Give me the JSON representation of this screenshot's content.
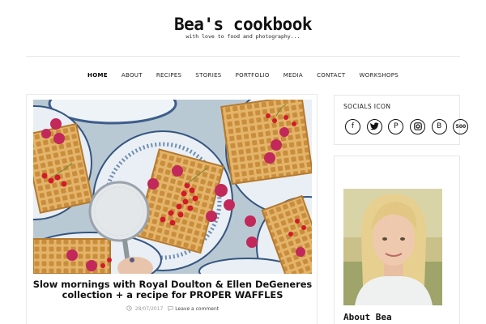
{
  "site": {
    "title": "Bea's cookbook",
    "tagline": "with love to food and photography..."
  },
  "nav": {
    "items": [
      "HOME",
      "ABOUT",
      "RECIPES",
      "STORIES",
      "PORTFOLIO",
      "MEDIA",
      "CONTACT",
      "WORKSHOPS"
    ],
    "active": "HOME"
  },
  "post": {
    "title_line1": "Slow mornings with Royal Doulton & Ellen DeGeneres",
    "title_line2": "collection + a recipe for PROPER WAFFLES",
    "date": "28/07/2017",
    "comment_label": "Leave a comment",
    "image_icon": "waffles-with-raspberries-photo"
  },
  "sidebar": {
    "socials_title": "SOCIALS ICON",
    "social_icons": [
      {
        "name": "facebook-icon",
        "glyph": "f"
      },
      {
        "name": "twitter-icon",
        "glyph": ""
      },
      {
        "name": "pinterest-icon",
        "glyph": "P"
      },
      {
        "name": "instagram-icon",
        "glyph": ""
      },
      {
        "name": "blogger-icon",
        "glyph": "B"
      },
      {
        "name": "500px-icon",
        "glyph": "500"
      }
    ],
    "about_title": "About Bea",
    "about_photo_icon": "portrait-photo"
  },
  "colors": {
    "text": "#111111",
    "meta": "#999999",
    "border": "#e8e8e8",
    "table_bg": "#b9c9d4"
  }
}
